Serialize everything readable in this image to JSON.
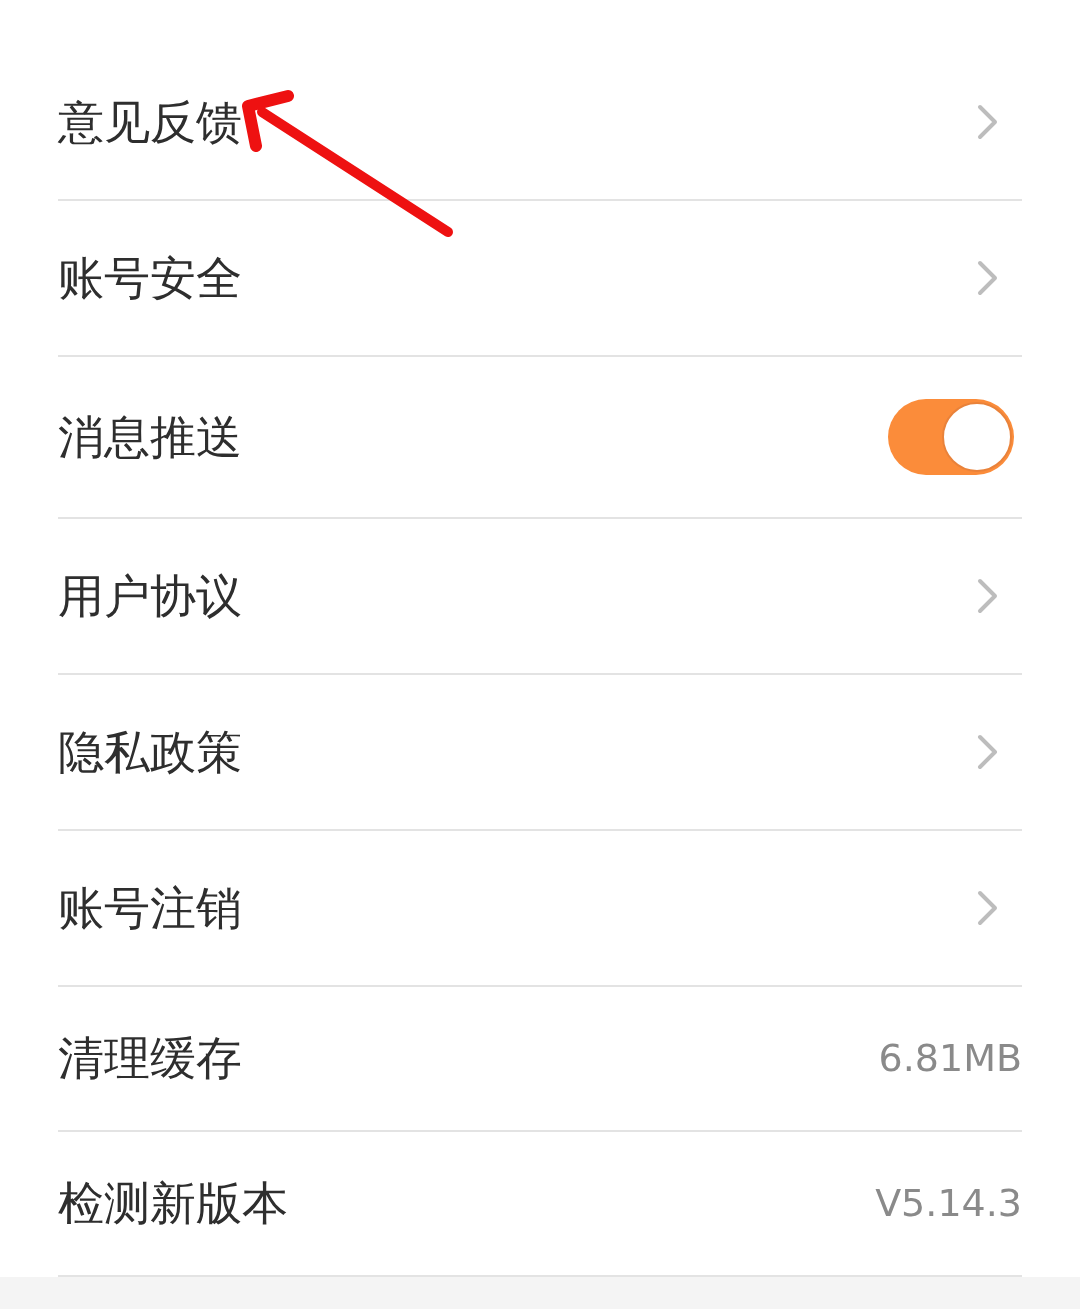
{
  "settings": [
    {
      "kind": "link",
      "label": "意见反馈"
    },
    {
      "kind": "link",
      "label": "账号安全"
    },
    {
      "kind": "toggle",
      "label": "消息推送",
      "on": true
    },
    {
      "kind": "link",
      "label": "用户协议"
    },
    {
      "kind": "link",
      "label": "隐私政策"
    },
    {
      "kind": "link",
      "label": "账号注销"
    },
    {
      "kind": "value",
      "label": "清理缓存",
      "value": "6.81MB"
    },
    {
      "kind": "value",
      "label": "检测新版本",
      "value": "V5.14.3"
    }
  ]
}
